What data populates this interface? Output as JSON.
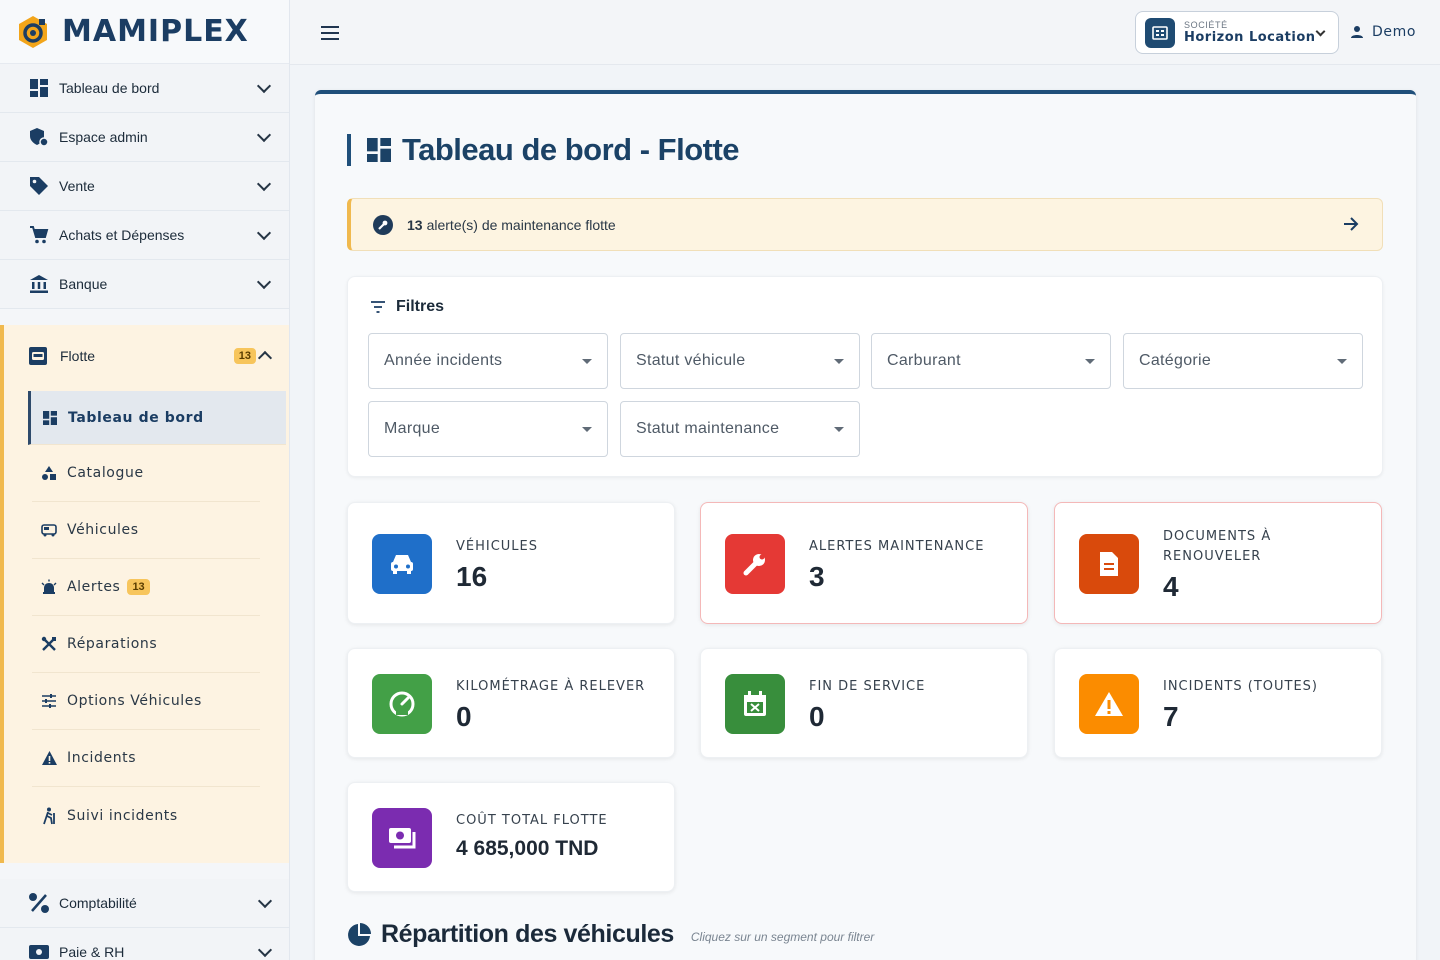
{
  "brand": {
    "name": "MAMIPLEX"
  },
  "sidebar": {
    "items": [
      {
        "label": "Tableau de bord",
        "icon": "dashboard-icon"
      },
      {
        "label": "Espace admin",
        "icon": "admin-shield-icon"
      },
      {
        "label": "Vente",
        "icon": "tag-icon"
      },
      {
        "label": "Achats et Dépenses",
        "icon": "cart-icon"
      },
      {
        "label": "Banque",
        "icon": "bank-icon"
      }
    ],
    "flotte": {
      "label": "Flotte",
      "badge": "13",
      "sub": [
        {
          "label": "Tableau de bord",
          "icon": "dashboard-icon"
        },
        {
          "label": "Catalogue",
          "icon": "shapes-icon"
        },
        {
          "label": "Véhicules",
          "icon": "bus-icon"
        },
        {
          "label": "Alertes",
          "icon": "alarm-icon",
          "badge": "13"
        },
        {
          "label": "Réparations",
          "icon": "tools-icon"
        },
        {
          "label": "Options Véhicules",
          "icon": "sliders-icon"
        },
        {
          "label": "Incidents",
          "icon": "warning-icon"
        },
        {
          "label": "Suivi incidents",
          "icon": "hiking-icon"
        }
      ]
    },
    "bottom": [
      {
        "label": "Comptabilité",
        "icon": "percent-icon"
      },
      {
        "label": "Paie & RH",
        "icon": "payroll-icon"
      }
    ]
  },
  "topbar": {
    "company_caption": "SOCIÉTÉ",
    "company_name": "Horizon Location",
    "user": "Demo"
  },
  "page": {
    "title": "Tableau de bord - Flotte",
    "alert_count": "13",
    "alert_text": "alerte(s) de maintenance flotte"
  },
  "filters": {
    "title": "Filtres",
    "selects": [
      "Année incidents",
      "Statut véhicule",
      "Carburant",
      "Catégorie",
      "Marque",
      "Statut maintenance"
    ]
  },
  "stats": [
    {
      "title": "VÉHICULES",
      "value": "16",
      "color": "#1f6fc9",
      "icon": "car-icon"
    },
    {
      "title": "ALERTES MAINTENANCE",
      "value": "3",
      "color": "#e53935",
      "icon": "wrench-icon"
    },
    {
      "title": "DOCUMENTS À RENOUVELER",
      "value": "4",
      "color": "#d94a0c",
      "icon": "document-icon"
    },
    {
      "title": "KILOMÉTRAGE À RELEVER",
      "value": "0",
      "color": "#43a047",
      "icon": "speedometer-icon"
    },
    {
      "title": "FIN DE SERVICE",
      "value": "0",
      "color": "#388e3c",
      "icon": "calendar-x-icon"
    },
    {
      "title": "INCIDENTS (TOUTES)",
      "value": "7",
      "color": "#fb8c00",
      "icon": "warning-icon"
    },
    {
      "title": "COÛT TOTAL FLOTTE",
      "value": "4 685,000 TND",
      "color": "#7b2cb0",
      "icon": "money-icon"
    }
  ],
  "section": {
    "title": "Répartition des véhicules",
    "hint": "Cliquez sur un segment pour filtrer"
  }
}
